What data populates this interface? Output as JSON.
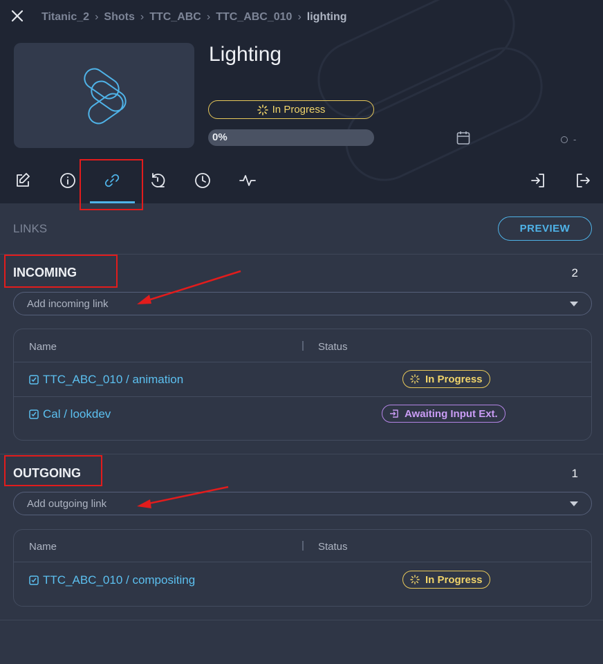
{
  "breadcrumb": [
    "Titanic_2",
    "Shots",
    "TTC_ABC",
    "TTC_ABC_010",
    "lighting"
  ],
  "task": {
    "title": "Lighting",
    "status": "In Progress",
    "status_color": "#e8c95a",
    "progress_label": "0%",
    "progress": 0,
    "extra_value": "-"
  },
  "toolbar": {
    "icons": [
      "edit-icon",
      "info-icon",
      "link-icon",
      "history-undo-icon",
      "clock-icon",
      "activity-icon",
      "login-icon",
      "logout-icon"
    ],
    "active": "link-icon",
    "accent": "#4fb3e8"
  },
  "links": {
    "label": "LINKS",
    "preview_label": "PREVIEW",
    "incoming": {
      "title": "INCOMING",
      "count": "2",
      "placeholder": "Add incoming link",
      "columns": [
        "Name",
        "Status"
      ],
      "rows": [
        {
          "name": "TTC_ABC_010 / animation",
          "status": "In Progress",
          "status_type": "in-progress"
        },
        {
          "name": "Cal / lookdev",
          "status": "Awaiting Input Ext.",
          "status_type": "awaiting"
        }
      ]
    },
    "outgoing": {
      "title": "OUTGOING",
      "count": "1",
      "placeholder": "Add outgoing link",
      "columns": [
        "Name",
        "Status"
      ],
      "rows": [
        {
          "name": "TTC_ABC_010 / compositing",
          "status": "In Progress",
          "status_type": "in-progress"
        }
      ]
    }
  },
  "colors": {
    "in_progress": "#e8c95a",
    "awaiting": "#b485e6",
    "link_text": "#5cc0f0",
    "annotation_red": "#e21c1c"
  }
}
